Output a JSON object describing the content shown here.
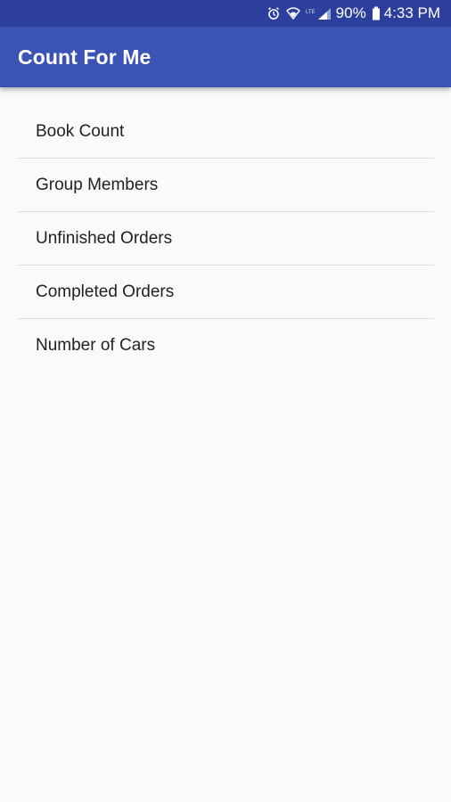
{
  "status_bar": {
    "icons": [
      "alarm-icon",
      "wifi-icon",
      "signal-icon",
      "battery-icon"
    ],
    "battery": "90%",
    "time": "4:33 PM"
  },
  "app_bar": {
    "title": "Count For Me"
  },
  "list": {
    "items": [
      {
        "label": "Book Count"
      },
      {
        "label": "Group Members"
      },
      {
        "label": "Unfinished Orders"
      },
      {
        "label": "Completed Orders"
      },
      {
        "label": "Number of Cars"
      }
    ]
  },
  "colors": {
    "status_bar": "#2c3f9c",
    "app_bar": "#3a53b5",
    "background": "#fafafa",
    "divider": "#dcdcdc"
  }
}
